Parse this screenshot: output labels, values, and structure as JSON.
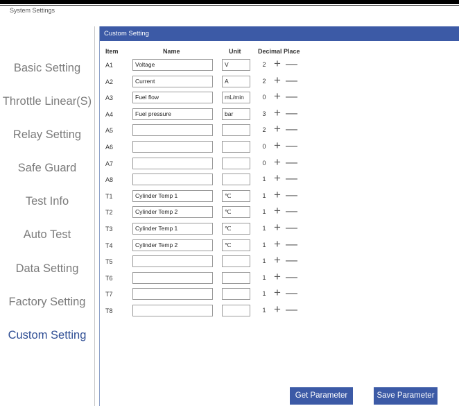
{
  "window": {
    "title": "System Settings"
  },
  "sidebar": {
    "items": [
      {
        "label": "Basic Setting",
        "active": false
      },
      {
        "label": "Throttle Linear(S)",
        "active": false
      },
      {
        "label": "Relay Setting",
        "active": false
      },
      {
        "label": "Safe Guard",
        "active": false
      },
      {
        "label": "Test Info",
        "active": false
      },
      {
        "label": "Auto Test",
        "active": false
      },
      {
        "label": "Data Setting",
        "active": false
      },
      {
        "label": "Factory Setting",
        "active": false
      },
      {
        "label": "Custom Setting",
        "active": true
      }
    ]
  },
  "panel": {
    "title": "Custom Setting",
    "headers": {
      "item": "Item",
      "name": "Name",
      "unit": "Unit",
      "decimal": "Decimal Place"
    },
    "rows": [
      {
        "item": "A1",
        "name": "Voltage",
        "unit": "V",
        "decimal": "2"
      },
      {
        "item": "A2",
        "name": "Current",
        "unit": "A",
        "decimal": "2"
      },
      {
        "item": "A3",
        "name": "Fuel flow",
        "unit": "mL/min",
        "decimal": "0"
      },
      {
        "item": "A4",
        "name": "Fuel pressure",
        "unit": "bar",
        "decimal": "3"
      },
      {
        "item": "A5",
        "name": "",
        "unit": "",
        "decimal": "2"
      },
      {
        "item": "A6",
        "name": "",
        "unit": "",
        "decimal": "0"
      },
      {
        "item": "A7",
        "name": "",
        "unit": "",
        "decimal": "0"
      },
      {
        "item": "A8",
        "name": "",
        "unit": "",
        "decimal": "1"
      },
      {
        "item": "T1",
        "name": "Cylinder Temp 1",
        "unit": "℃",
        "decimal": "1"
      },
      {
        "item": "T2",
        "name": "Cylinder Temp 2",
        "unit": "℃",
        "decimal": "1"
      },
      {
        "item": "T3",
        "name": "Cylinder Temp 1",
        "unit": "℃",
        "decimal": "1"
      },
      {
        "item": "T4",
        "name": "Cylinder Temp 2",
        "unit": "℃",
        "decimal": "1"
      },
      {
        "item": "T5",
        "name": "",
        "unit": "",
        "decimal": "1"
      },
      {
        "item": "T6",
        "name": "",
        "unit": "",
        "decimal": "1"
      },
      {
        "item": "T7",
        "name": "",
        "unit": "",
        "decimal": "1"
      },
      {
        "item": "T8",
        "name": "",
        "unit": "",
        "decimal": "1"
      }
    ],
    "plus_symbol": "+",
    "minus_symbol": "—"
  },
  "buttons": {
    "get": "Get Parameter",
    "save": "Save Parameter"
  },
  "colors": {
    "accent": "#3c5aa6",
    "active_text": "#2f4e94",
    "inactive_text": "#7b7b7b"
  }
}
